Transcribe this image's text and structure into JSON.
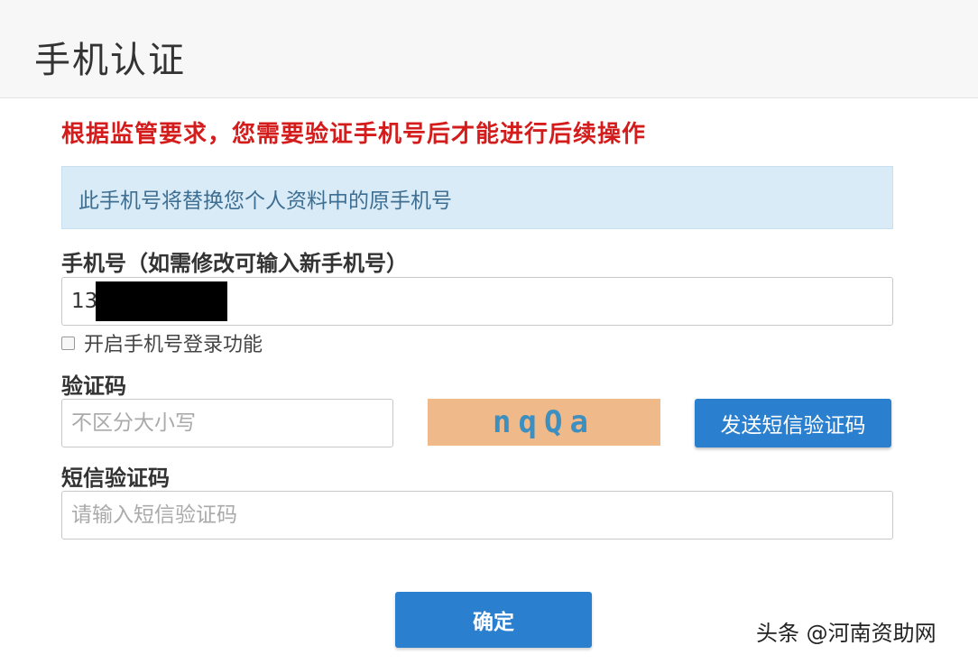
{
  "header": {
    "title": "手机认证"
  },
  "warning_text": "根据监管要求，您需要验证手机号后才能进行后续操作",
  "info_text": "此手机号将替换您个人资料中的原手机号",
  "phone": {
    "label": "手机号（如需修改可输入新手机号）",
    "value": "13"
  },
  "login_option": {
    "label": "开启手机号登录功能",
    "checked": false
  },
  "captcha": {
    "label": "验证码",
    "placeholder": "不区分大小写",
    "image_text": "nqQa",
    "send_button": "发送短信验证码"
  },
  "sms": {
    "label": "短信验证码",
    "placeholder": "请输入短信验证码"
  },
  "confirm_button": "确定",
  "watermark": "头条 @河南资助网",
  "colors": {
    "warning": "#d41c1c",
    "info_bg": "#d9ebf7",
    "primary_button": "#2a7fcf",
    "captcha_bg": "#f0b98a"
  }
}
